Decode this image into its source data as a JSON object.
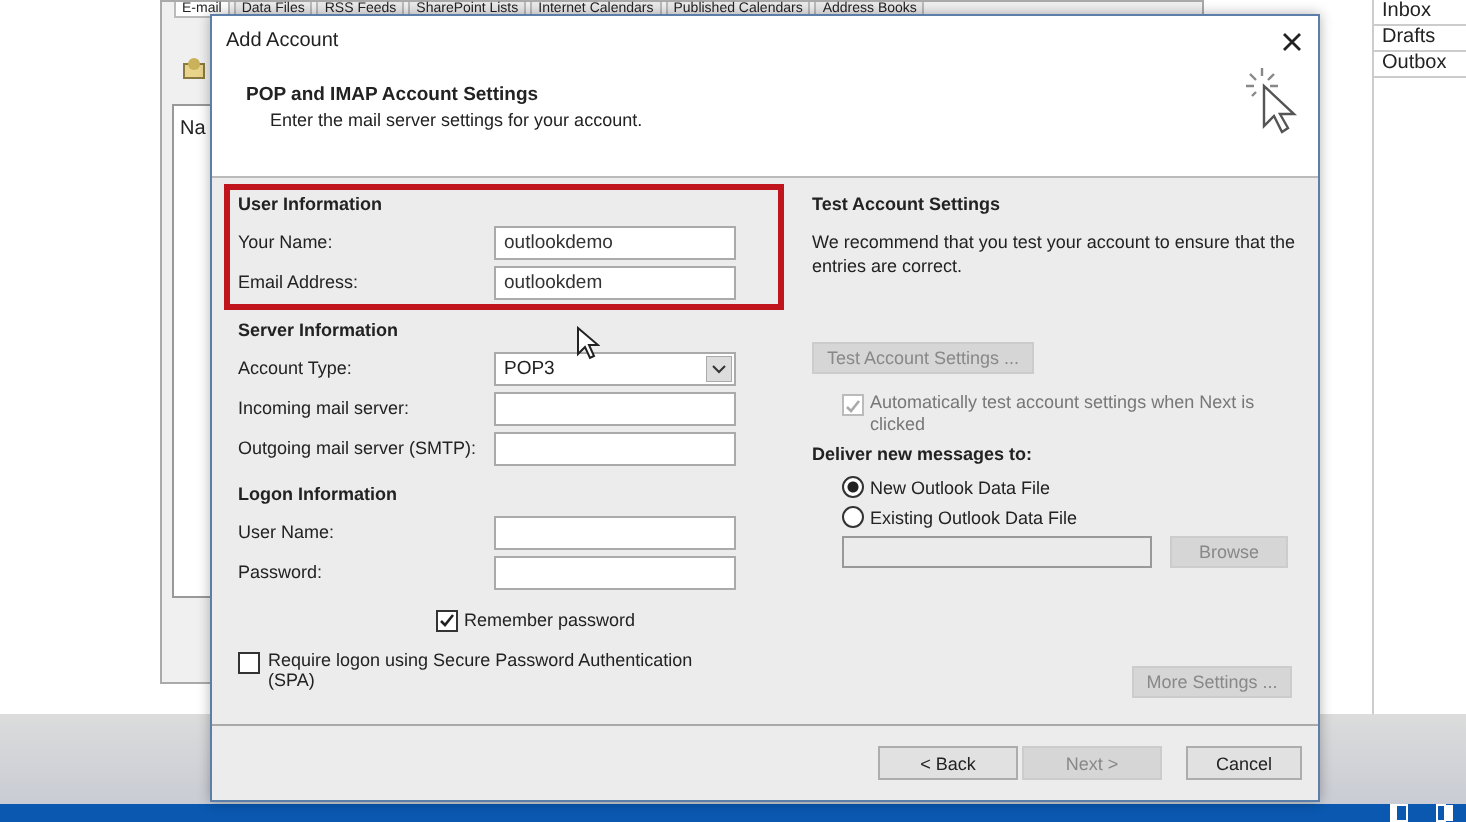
{
  "background_window": {
    "tabs": [
      {
        "label": "E-mail",
        "selected": true
      },
      {
        "label": "Data Files",
        "selected": false
      },
      {
        "label": "RSS Feeds",
        "selected": false
      },
      {
        "label": "SharePoint Lists",
        "selected": false
      },
      {
        "label": "Internet Calendars",
        "selected": false
      },
      {
        "label": "Published Calendars",
        "selected": false
      },
      {
        "label": "Address Books",
        "selected": false
      }
    ],
    "list_column": "Na"
  },
  "folder_pane": {
    "folders": [
      "Inbox",
      "Drafts",
      "Outbox"
    ]
  },
  "dialog": {
    "title": "Add Account",
    "header": {
      "title": "POP and IMAP Account Settings",
      "subtitle": "Enter the mail server settings for your account."
    },
    "sections": [
      {
        "heading": "User Information",
        "highlighted": true,
        "fields": [
          {
            "label": "Your Name:",
            "kind": "text",
            "value": "outlookdemo"
          },
          {
            "label": "Email Address:",
            "kind": "text",
            "value": "outlookdem"
          }
        ]
      },
      {
        "heading": "Server Information",
        "highlighted": false,
        "fields": [
          {
            "label": "Account Type:",
            "kind": "dropdown",
            "value": "POP3"
          },
          {
            "label": "Incoming mail server:",
            "kind": "text"
          },
          {
            "label": "Outgoing mail server (SMTP):",
            "kind": "text"
          }
        ]
      },
      {
        "heading": "Logon Information",
        "highlighted": false,
        "fields": [
          {
            "label": "User Name:",
            "kind": "text"
          },
          {
            "label": "Password:",
            "kind": "text"
          }
        ]
      }
    ],
    "remember_password": {
      "label": "Remember password",
      "checked": true
    },
    "spa": {
      "label": "Require logon using Secure Password Authentication (SPA)",
      "checked": false
    },
    "test_settings": {
      "heading": "Test Account Settings",
      "text": "We recommend that you test your account to ensure that the entries are correct.",
      "button": {
        "label": "Test Account Settings ...",
        "disabled": true
      },
      "auto_test": {
        "label": "Automatically test account settings when Next is clicked",
        "checked": true,
        "disabled": true
      }
    },
    "deliver": {
      "heading": "Deliver new messages to:",
      "options": [
        {
          "label": "New Outlook Data File",
          "selected": true
        },
        {
          "label": "Existing Outlook Data File",
          "selected": false
        }
      ],
      "browse_button": {
        "label": "Browse",
        "disabled": true
      }
    },
    "more_settings": {
      "label": "More Settings ...",
      "disabled": true
    },
    "footer_buttons": [
      {
        "label": "< Back",
        "disabled": false
      },
      {
        "label": "Next >",
        "disabled": true
      },
      {
        "label": "Cancel",
        "disabled": false
      }
    ]
  }
}
